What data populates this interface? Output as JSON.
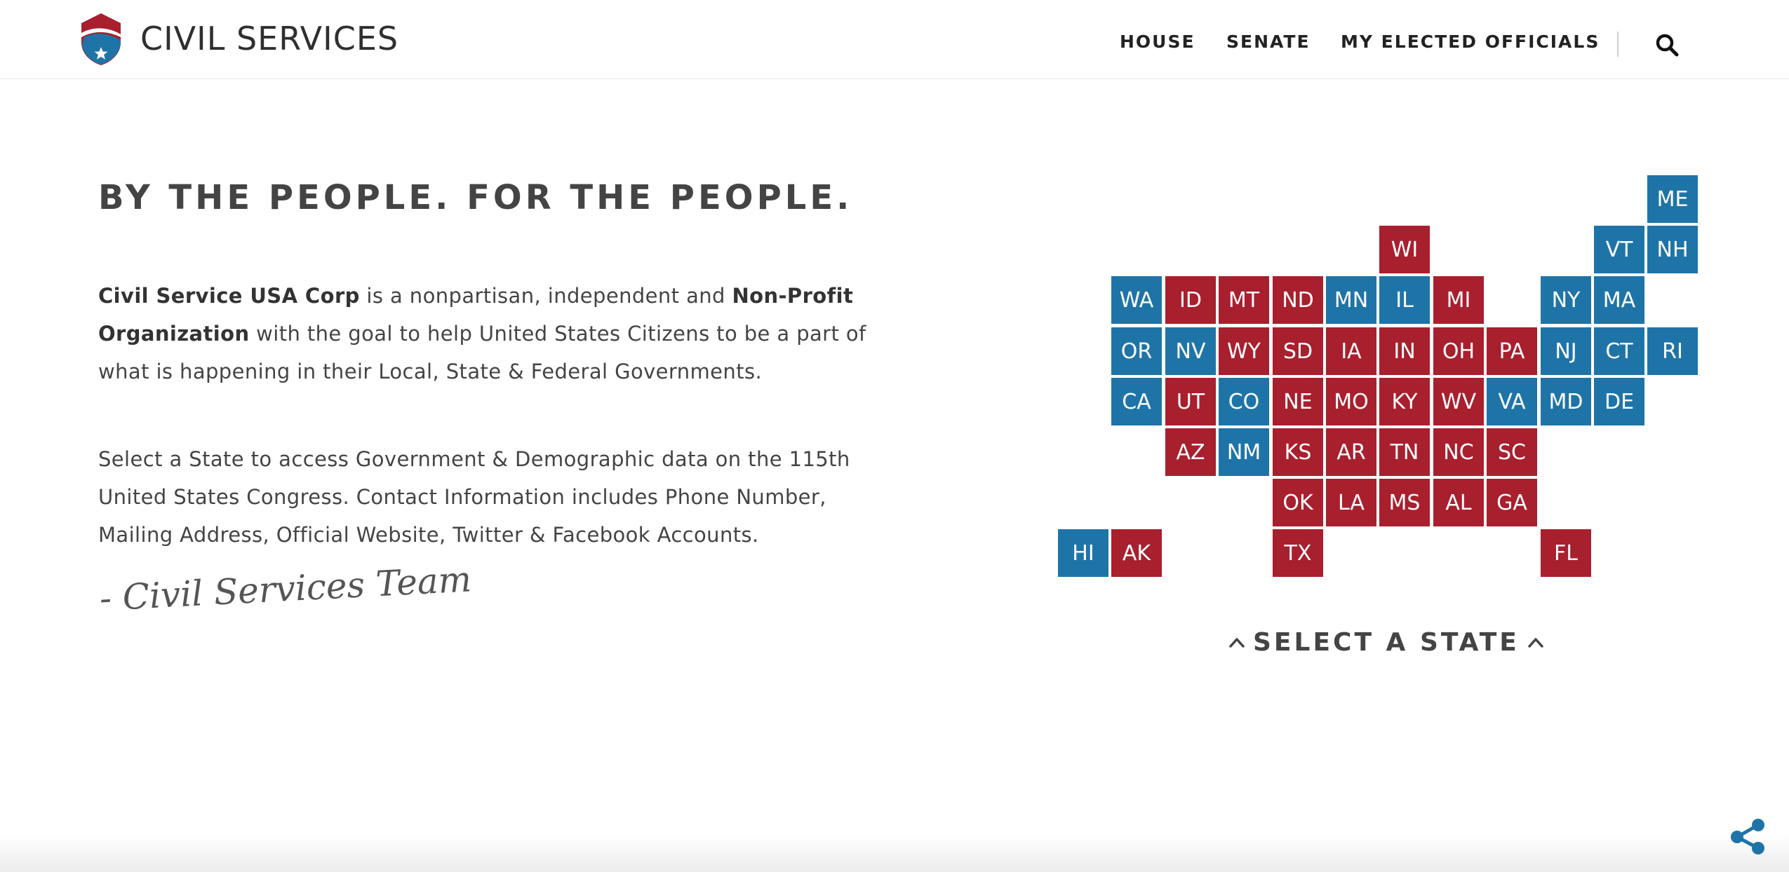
{
  "header": {
    "brand": "CIVIL SERVICES",
    "nav": [
      "HOUSE",
      "SENATE",
      "MY ELECTED OFFICIALS"
    ],
    "icons": {
      "logo": "shield-star-logo",
      "search": "search-icon"
    }
  },
  "intro": {
    "headline": "BY THE PEOPLE. FOR THE PEOPLE.",
    "para1": {
      "org_name": "Civil Service USA Corp",
      "text_a": " is a nonpartisan, independent and ",
      "org_type": "Non-Profit Organization",
      "text_b": " with the goal to help United States Citizens to be a part of what is happening in their Local, State & Federal Governments."
    },
    "para2": "Select a State to access Government & Demographic data on the 115th United States Congress. Contact Information includes Phone Number, Mailing Address, Official Website, Twitter & Facebook Accounts.",
    "signature": "- Civil Services Team"
  },
  "map": {
    "select_label": "SELECT A STATE",
    "colors": {
      "blue": "#1f74a7",
      "red": "#a81f2e"
    },
    "states": [
      {
        "abbr": "ME",
        "party": "blue"
      },
      {
        "abbr": "WI",
        "party": "red"
      },
      {
        "abbr": "VT",
        "party": "blue"
      },
      {
        "abbr": "NH",
        "party": "blue"
      },
      {
        "abbr": "WA",
        "party": "blue"
      },
      {
        "abbr": "ID",
        "party": "red"
      },
      {
        "abbr": "MT",
        "party": "red"
      },
      {
        "abbr": "ND",
        "party": "red"
      },
      {
        "abbr": "MN",
        "party": "blue"
      },
      {
        "abbr": "IL",
        "party": "blue"
      },
      {
        "abbr": "MI",
        "party": "red"
      },
      {
        "abbr": "NY",
        "party": "blue"
      },
      {
        "abbr": "MA",
        "party": "blue"
      },
      {
        "abbr": "OR",
        "party": "blue"
      },
      {
        "abbr": "NV",
        "party": "blue"
      },
      {
        "abbr": "WY",
        "party": "red"
      },
      {
        "abbr": "SD",
        "party": "red"
      },
      {
        "abbr": "IA",
        "party": "red"
      },
      {
        "abbr": "IN",
        "party": "red"
      },
      {
        "abbr": "OH",
        "party": "red"
      },
      {
        "abbr": "PA",
        "party": "red"
      },
      {
        "abbr": "NJ",
        "party": "blue"
      },
      {
        "abbr": "CT",
        "party": "blue"
      },
      {
        "abbr": "RI",
        "party": "blue"
      },
      {
        "abbr": "CA",
        "party": "blue"
      },
      {
        "abbr": "UT",
        "party": "red"
      },
      {
        "abbr": "CO",
        "party": "blue"
      },
      {
        "abbr": "NE",
        "party": "red"
      },
      {
        "abbr": "MO",
        "party": "red"
      },
      {
        "abbr": "KY",
        "party": "red"
      },
      {
        "abbr": "WV",
        "party": "red"
      },
      {
        "abbr": "VA",
        "party": "blue"
      },
      {
        "abbr": "MD",
        "party": "blue"
      },
      {
        "abbr": "DE",
        "party": "blue"
      },
      {
        "abbr": "AZ",
        "party": "red"
      },
      {
        "abbr": "NM",
        "party": "blue"
      },
      {
        "abbr": "KS",
        "party": "red"
      },
      {
        "abbr": "AR",
        "party": "red"
      },
      {
        "abbr": "TN",
        "party": "red"
      },
      {
        "abbr": "NC",
        "party": "red"
      },
      {
        "abbr": "SC",
        "party": "red"
      },
      {
        "abbr": "OK",
        "party": "red"
      },
      {
        "abbr": "LA",
        "party": "red"
      },
      {
        "abbr": "MS",
        "party": "red"
      },
      {
        "abbr": "AL",
        "party": "red"
      },
      {
        "abbr": "GA",
        "party": "red"
      },
      {
        "abbr": "HI",
        "party": "blue"
      },
      {
        "abbr": "AK",
        "party": "red"
      },
      {
        "abbr": "TX",
        "party": "red"
      },
      {
        "abbr": "FL",
        "party": "red"
      }
    ]
  },
  "share": {
    "icon": "share-icon"
  }
}
